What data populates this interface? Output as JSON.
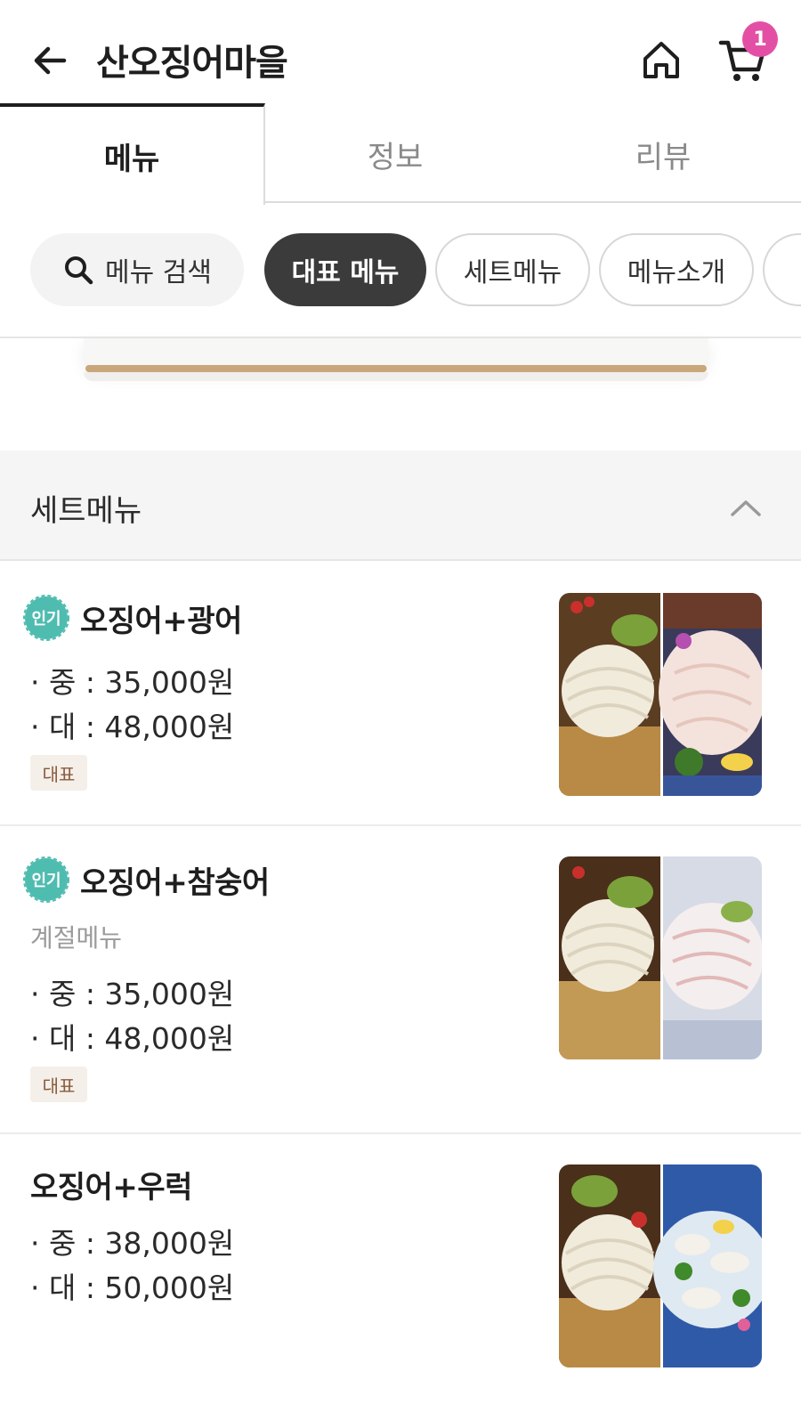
{
  "header": {
    "title": "산오징어마을",
    "cart_count": "1"
  },
  "tabs": [
    {
      "label": "메뉴",
      "active": true
    },
    {
      "label": "정보",
      "active": false
    },
    {
      "label": "리뷰",
      "active": false
    }
  ],
  "filters": {
    "search_label": "메뉴 검색",
    "chips": [
      "대표 메뉴",
      "세트메뉴",
      "메뉴소개"
    ]
  },
  "section": {
    "title": "세트메뉴"
  },
  "items": [
    {
      "badge": "인기",
      "name": "오징어+광어",
      "desc": "",
      "prices": [
        "· 중 : 35,000원",
        "· 대 : 48,000원"
      ],
      "tag": "대표"
    },
    {
      "badge": "인기",
      "name": "오징어+참숭어",
      "desc": "계절메뉴",
      "prices": [
        "· 중 : 35,000원",
        "· 대 : 48,000원"
      ],
      "tag": "대표"
    },
    {
      "badge": "",
      "name": "오징어+우럭",
      "desc": "",
      "prices": [
        "· 중 : 38,000원",
        "· 대 : 50,000원"
      ],
      "tag": ""
    }
  ],
  "colors": {
    "accent_badge": "#e44fa6",
    "popular_badge": "#4fbcb0",
    "selected_chip": "#3b3b3b",
    "tag_bg": "#f4efe9",
    "tag_text": "#8a5a3a"
  },
  "icons": [
    "back-arrow-icon",
    "home-icon",
    "cart-icon",
    "search-icon",
    "chevron-up-icon"
  ]
}
